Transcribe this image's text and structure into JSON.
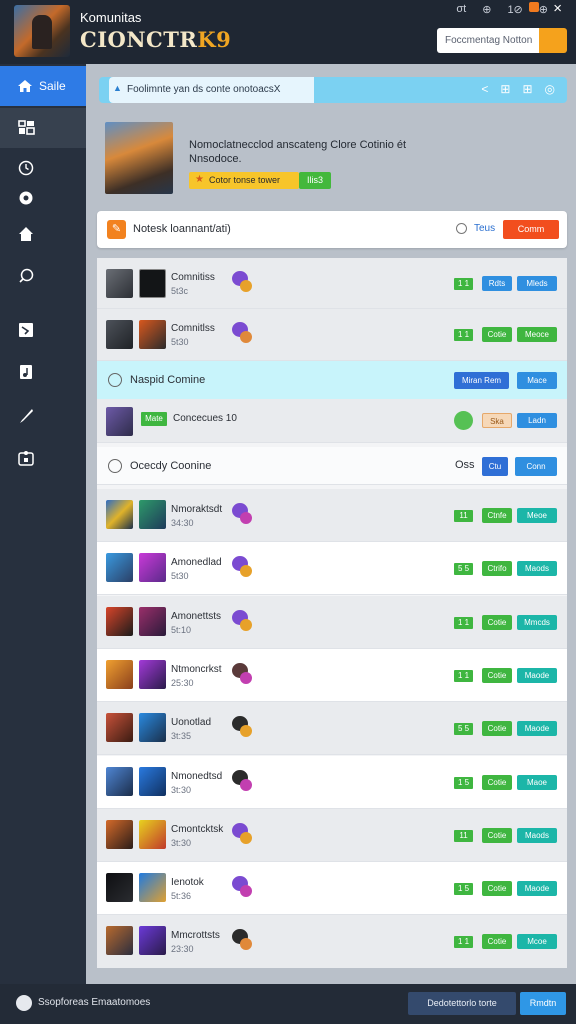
{
  "header": {
    "brand_top": "Komunitas",
    "brand_bottom": "CIONCTR",
    "brand_accent": "K9",
    "top_icons": [
      "σt",
      "⊕",
      "1⊘",
      "⊕"
    ],
    "close": "×",
    "search_placeholder": "Foccmentag  Notton"
  },
  "sidebar": {
    "active_label": "Saile",
    "icons": [
      "home-icon",
      "grid-icon",
      "clock-icon",
      "compass-icon",
      "house-icon",
      "chat-icon",
      "share-icon",
      "music-icon",
      "brush-icon",
      "puzzle-icon"
    ]
  },
  "notice": {
    "text": "Foolimnte yan ds conte onotoacs",
    "x_mark": "X",
    "icons": [
      "<",
      "⊞",
      "⊞",
      "◎"
    ]
  },
  "featured": {
    "title": "Nomoclatnecclod  anscateng  Clore Cotinio ét",
    "subtitle": "Nnsodoce.",
    "btn1": "Cotor tonse tower",
    "btn2": "Ilis3"
  },
  "filter": {
    "label": "Notesk loannant/ati)",
    "link": "Teus",
    "button": "Comm"
  },
  "groups": [
    {
      "label": "Naspid Comine",
      "btnA": "Miran Rem",
      "btnB": "Mace"
    },
    {
      "label": "Ocecdy Coonine",
      "extra": "Oss",
      "btnA": "Ctu",
      "btnB": "Conn"
    }
  ],
  "single_row": {
    "tag": "Mate",
    "name": "Concecues 10",
    "btnA": "Ska",
    "btnB": "Ladn"
  },
  "rows_top": [
    {
      "name": "Comnitiss",
      "sub": "5t3c",
      "num": "1 1",
      "btnA": "Rdts",
      "btnB": "Mleds"
    },
    {
      "name": "Comnitlss",
      "sub": "5t30",
      "num": "1 1",
      "btnA": "Cotie",
      "btnB": "Meoce"
    }
  ],
  "rows_bottom": [
    {
      "name": "Nmoraktsdt",
      "sub": "34:30",
      "num": "11",
      "btnA": "Ctnfe",
      "btnB": "Meoe"
    },
    {
      "name": "Amonedlad",
      "sub": "5t30",
      "num": "5 5",
      "btnA": "Ctrifo",
      "btnB": "Maods"
    },
    {
      "name": "Amonettsts",
      "sub": "5t:10",
      "num": "1 1",
      "btnA": "Cotie",
      "btnB": "Mmcds"
    },
    {
      "name": "Ntmoncrkst",
      "sub": "25:30",
      "num": "1 1",
      "btnA": "Cotie",
      "btnB": "Maode"
    },
    {
      "name": "Uonotlad",
      "sub": "3t:35",
      "num": "5 5",
      "btnA": "Cotie",
      "btnB": "Maode"
    },
    {
      "name": "Nmonedtsd",
      "sub": "3t:30",
      "num": "1 5",
      "btnA": "Cotie",
      "btnB": "Maoe"
    },
    {
      "name": "Cmontcktsk",
      "sub": "3t:30",
      "num": "11",
      "btnA": "Cotie",
      "btnB": "Maods"
    },
    {
      "name": "Ienotok",
      "sub": "5t:36",
      "num": "1 5",
      "btnA": "Cotie",
      "btnB": "Maode"
    },
    {
      "name": "Mmcrottsts",
      "sub": "23:30",
      "num": "1 1",
      "btnA": "Cotie",
      "btnB": "Mcoe"
    }
  ],
  "footer": {
    "label": "Ssopforeas  Emaatomoes",
    "btn1": "Dedotettorlo torte",
    "btn2": "Rmdtn"
  },
  "colors": {
    "accent": "#2e7be6",
    "orange": "#f24e1e",
    "green": "#3fb640",
    "blue_btn": "#2f8fe0",
    "teal_btn": "#1cb6a8"
  }
}
